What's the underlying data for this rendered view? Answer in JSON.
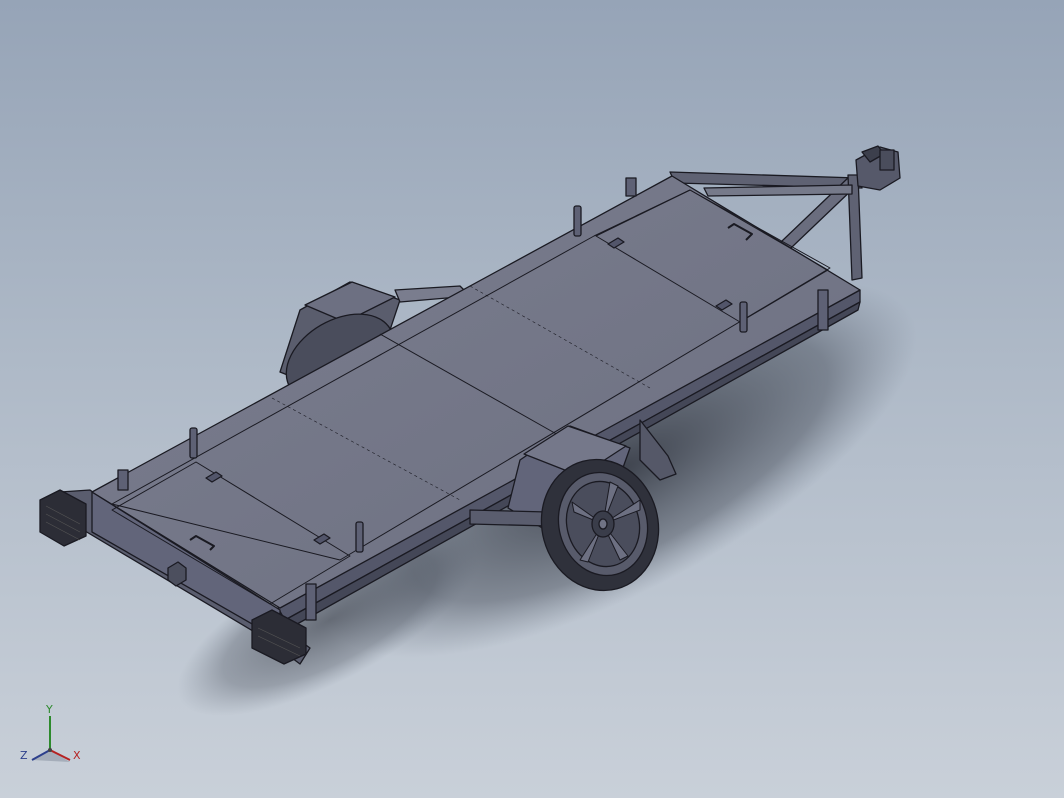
{
  "viewport": {
    "background_top": "#96a4b7",
    "background_bottom": "#c9d0d9"
  },
  "model": {
    "body_color": "#6f7283",
    "edge_color": "#1a1a22",
    "icon": "trailer-3d-model"
  },
  "triad": {
    "x_label": "X",
    "y_label": "Y",
    "z_label": "Z",
    "x_color": "#b52222",
    "y_color": "#2d8a2d",
    "z_color": "#2c3f8c"
  }
}
